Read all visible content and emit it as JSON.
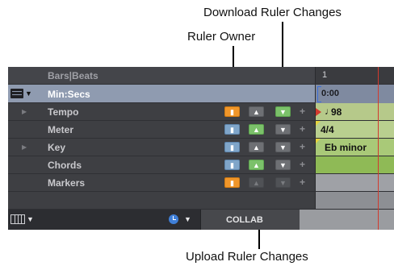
{
  "callouts": {
    "download": "Download Ruler Changes",
    "owner": "Ruler Owner",
    "upload": "Upload Ruler Changes"
  },
  "rulers": {
    "bars_beats": "Bars|Beats",
    "min_secs": "Min:Secs",
    "tempo": "Tempo",
    "meter": "Meter",
    "key": "Key",
    "chords": "Chords",
    "markers": "Markers"
  },
  "timeline": {
    "bar_number": "1",
    "min_secs_value": "0:00",
    "tempo_value": "98",
    "meter_value": "4/4",
    "key_value": "Eb minor"
  },
  "footer": {
    "collab_label": "COLLAB"
  },
  "colors": {
    "owner_orange": "#f0962a",
    "download_green": "#7bc16a",
    "owner_blue": "#7fa5c9",
    "tempo_track": "#b6c98a",
    "meter_track": "#b9cf8f",
    "key_track": "#a9c978",
    "chords_track": "#8fba56",
    "playhead_red": "#d23a2e"
  },
  "icons": {
    "ruler_menu": "ruler-menu-icon",
    "view_selector": "view-selector-icon",
    "clock": "clock-icon",
    "owner_button": "person-icon",
    "upload_button": "up-arrow-icon",
    "download_button": "down-arrow-icon",
    "add": "plus-icon"
  }
}
